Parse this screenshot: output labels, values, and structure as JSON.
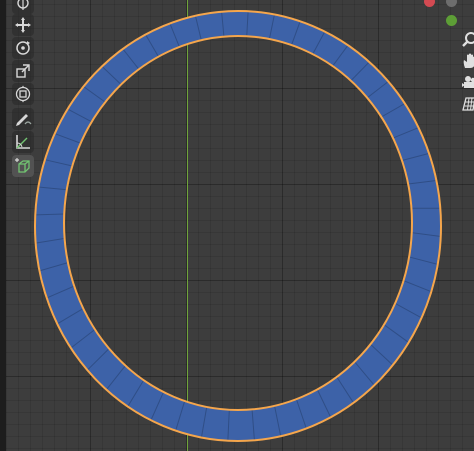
{
  "colors": {
    "viewport_bg": "#3d3d3d",
    "y_axis": "#6fa33b",
    "ring_fill": "#3d62a8",
    "ring_selection_outline": "#f5a64c",
    "gizmo_green": "#5d9e36",
    "gizmo_red": "#d34a52"
  },
  "viewport": {
    "selected_object": "ring-mesh"
  },
  "left_toolbar": {
    "tools": [
      {
        "name": "cursor",
        "icon": "cursor-icon"
      },
      {
        "name": "move",
        "icon": "move-icon"
      },
      {
        "name": "rotate",
        "icon": "rotate-icon"
      },
      {
        "name": "scale",
        "icon": "scale-icon"
      },
      {
        "name": "transform",
        "icon": "transform-icon"
      },
      {
        "name": "annotate",
        "icon": "annotate-icon"
      },
      {
        "name": "measure",
        "icon": "measure-icon"
      },
      {
        "name": "add-cube",
        "icon": "add-cube-icon",
        "active": true
      }
    ]
  },
  "right_gizmos": {
    "items": [
      {
        "name": "zoom",
        "icon": "zoom-icon"
      },
      {
        "name": "pan",
        "icon": "hand-icon"
      },
      {
        "name": "camera",
        "icon": "camera-icon"
      },
      {
        "name": "perspective",
        "icon": "grid-icon"
      }
    ]
  }
}
